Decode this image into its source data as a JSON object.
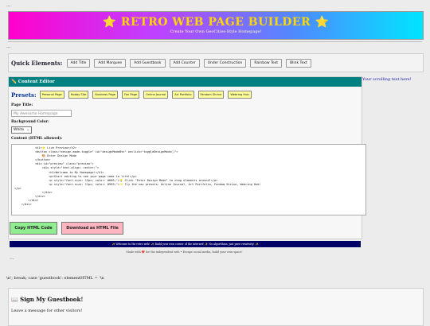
{
  "top_ellipsis": "...",
  "header": {
    "title": "⭐ RETRO WEB PAGE BUILDER ⭐",
    "subtitle": "Create Your Own GeoCities-Style Homepage!"
  },
  "mid_ellipsis": "...",
  "quick_elements": {
    "label": "Quick Elements:",
    "buttons": [
      "Add Title",
      "Add Marquee",
      "Add Guestbook",
      "Add Counter",
      "Under Construction",
      "Rainbow Text",
      "Blink Text"
    ]
  },
  "scrolling_text": "Your scrolling text here!",
  "editor": {
    "title": "✏️ Content Editor",
    "presets_label": "Presets:",
    "presets": [
      "Personal Page",
      "Hobby Site",
      "Business Page",
      "Fan Page",
      "Online Journal",
      "Art Portfolio",
      "Fandom Shrine",
      "Webring Hub"
    ],
    "page_title_label": "Page Title:",
    "page_title_placeholder": "My Awesome Homepage",
    "bg_color_label": "Background Color:",
    "bg_color_value": "White",
    "content_label": "Content (HTML allowed):",
    "code_lines": [
      "            <h1>⭐ Live Preview</h2>",
      "            <button class=\"design-mode-toggle\" id=\"designModeBtn\" onclick=\"toggleDesignMode()\">",
      "                🎨 Enter Design Mode",
      "            </button>",
      "            <div id=\"preview\" class=\"preview\">",
      "                <div style=\"text-align: center;\">",
      "                    <h1>Welcome to My Homepage!</h1>",
      "                    <p>Start editing to see your page come to life!</p>",
      "                    <p style=\"font-size: 12px; color: #666;\">💡 Click \"Enter Design Mode\" to drag elements around!</p>",
      "                    <p style=\"font-size: 11px; color: #999;\">✨ Try the new presets: Online Journal, Art Portfolio, Fandom Shrine, Webring Hub!",
      "</p>",
      "                </div>",
      "            </div>",
      "        </div>",
      "    </div>"
    ]
  },
  "actions": {
    "copy": "Copy HTML Code",
    "download": "Download as HTML File"
  },
  "marquee": "✨ Welcome to the retro web! ✨ Build your own corner of the internet! ✨ No algorithms, just pure creativity! ✨",
  "made_with": "Made with ❤️ for the independent web • Escape social media, build your own space!",
  "bottom_ellipsis": "...",
  "leaked_code": "\\n'; break; case 'guestbook': elementHTML = '\\n",
  "guestbook": {
    "title": "📖 Sign My Guestbook!",
    "subtitle": "Leave a message for other visitors!"
  }
}
